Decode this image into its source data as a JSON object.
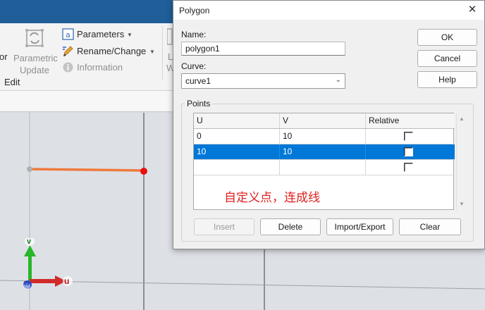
{
  "ribbon": {
    "btn_or_label": "or",
    "parametric_update_line1": "Parametric",
    "parametric_update_line2": "Update",
    "parameters_label": "Parameters",
    "rename_change_label": "Rename/Change",
    "information_label": "Information",
    "group_edit_label": "Edit",
    "cut_letter_l": "L",
    "cut_letter_w": "W"
  },
  "viewport": {
    "axis_v_label": "v",
    "axis_u_label": "u",
    "axis_w_label": "w",
    "line_color": "#f07a3c",
    "point_color": "#e81010"
  },
  "dialog": {
    "title": "Polygon",
    "close_glyph": "✕",
    "name_label": "Name:",
    "name_value": "polygon1",
    "curve_label": "Curve:",
    "curve_value": "curve1",
    "ok_label": "OK",
    "cancel_label": "Cancel",
    "help_label": "Help",
    "points_group_label": "Points",
    "table": {
      "headers": [
        "U",
        "V",
        "Relative"
      ],
      "rows": [
        {
          "u": "0",
          "v": "10",
          "relative": false
        },
        {
          "u": "10",
          "v": "10",
          "relative": false,
          "selected": true
        },
        {
          "u": "",
          "v": "",
          "relative": false
        }
      ]
    },
    "annotation": "自定义点，连成线",
    "insert_label": "Insert",
    "delete_label": "Delete",
    "import_export_label": "Import/Export",
    "clear_label": "Clear",
    "accent_color": "#0078d7"
  }
}
